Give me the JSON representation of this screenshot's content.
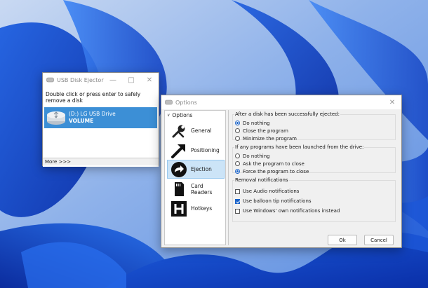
{
  "desktop": {
    "wallpaper": "windows-11-bloom-blue"
  },
  "ejector": {
    "title": "USB Disk Ejector",
    "hint": "Double click or press enter to safely remove a disk",
    "drive": {
      "name": "(D:) LG USB Drive",
      "volume": "VOLUME"
    },
    "more": "More >>>"
  },
  "options": {
    "title": "Options",
    "nav": {
      "header": "Options",
      "items": [
        {
          "label": "General",
          "icon": "wrench-icon"
        },
        {
          "label": "Positioning",
          "icon": "arrow-icon"
        },
        {
          "label": "Ejection",
          "icon": "eject-icon",
          "selected": true
        },
        {
          "label": "Card Readers",
          "icon": "sd-card-icon"
        },
        {
          "label": "Hotkeys",
          "icon": "h-key-icon"
        }
      ]
    },
    "after_eject": {
      "title": "After a disk has been successfully ejected:",
      "options": [
        "Do nothing",
        "Close the program",
        "Minimize the program"
      ],
      "selected": 0
    },
    "programs_launched": {
      "title": "If any programs have been launched from the drive:",
      "options": [
        "Do nothing",
        "Ask the program to close",
        "Force the program to close"
      ],
      "selected": 2
    },
    "removal": {
      "title": "Removal notifications",
      "options": [
        {
          "label": "Use Audio notifications",
          "checked": false
        },
        {
          "label": "Use balloon tip notifications",
          "checked": true
        },
        {
          "label": "Use Windows' own notifications instead",
          "checked": false
        }
      ]
    },
    "buttons": {
      "ok": "Ok",
      "cancel": "Cancel"
    }
  },
  "colors": {
    "accent": "#1a63c9",
    "selection": "#3c8fd6",
    "nav_selected": "#cce4f7"
  }
}
